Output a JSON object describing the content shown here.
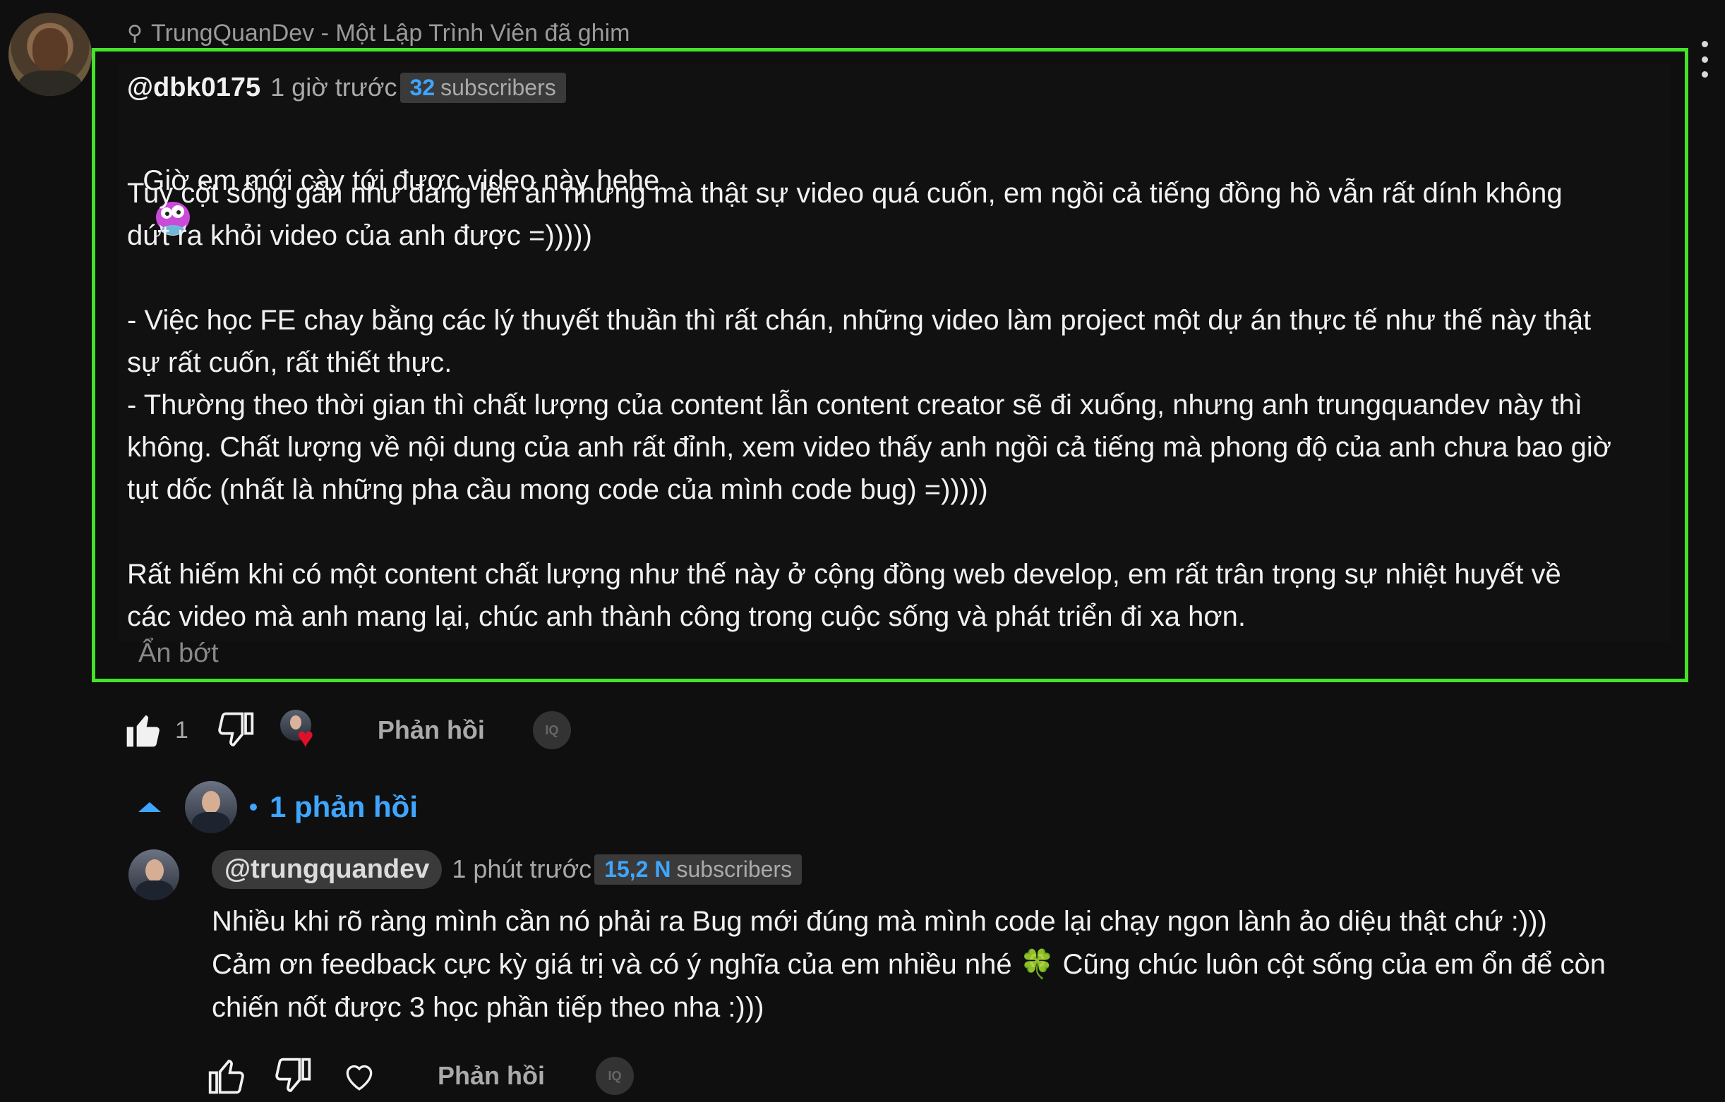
{
  "pinned": {
    "icon": "pin-icon",
    "text": "TrungQuanDev - Một Lập Trình Viên đã ghim"
  },
  "comment": {
    "author": "@dbk0175",
    "time": "1 giờ trước",
    "subscribers_count": "32",
    "subscribers_label": "subscribers",
    "line1": "Giờ em mới cày tới được video này hehe",
    "paragraph1": "Tuy cột sống gần như đang lên án nhưng mà thật sự video quá cuốn, em ngồi cả tiếng đồng hồ vẫn rất dính không\ndứt ra khỏi video của anh được =)))))",
    "paragraph2": "- Việc học FE chay bằng các lý thuyết thuần thì rất chán, những video làm project một dự án thực tế như thế này thật\nsự rất cuốn, rất thiết thực.\n- Thường theo thời gian thì chất lượng của content lẫn content creator sẽ đi xuống, nhưng anh trungquandev này thì\nkhông. Chất lượng về nội dung của anh rất đỉnh, xem video thấy anh ngồi cả tiếng mà phong độ của anh chưa bao giờ\ntụt dốc (nhất là những pha cầu mong code của mình code bug) =)))))",
    "paragraph3": "Rất hiếm khi có một content chất lượng như thế này ở cộng đồng web develop, em rất trân trọng sự nhiệt huyết về\ncác video mà anh mang lại, chúc anh thành công trong cuộc sống và phát triển đi xa hơn.",
    "show_less": "Ẩn bớt",
    "like_count": "1",
    "reply_label": "Phản hồi",
    "highlight_color": "#44e32a"
  },
  "replies_toggle": {
    "label": "1 phản hồi"
  },
  "reply": {
    "author": "@trungquandev",
    "time": "1 phút trước",
    "subscribers_count": "15,2 N",
    "subscribers_label": "subscribers",
    "text_part1": "Nhiều khi rõ ràng mình cần nó phải ra Bug mới đúng mà mình code lại chạy ngon lành ảo diệu thật chứ :)))\nCảm ơn feedback cực kỳ giá trị và có ý nghĩa của em nhiều nhé ",
    "emoji": "🍀",
    "text_part2": " Cũng chúc luôn cột sống của em ổn để còn\nchiến nốt được 3 học phần tiếp theo nha :)))",
    "reply_label": "Phản hồi"
  },
  "colors": {
    "accent": "#3ea6ff",
    "heart": "#e0102a"
  }
}
